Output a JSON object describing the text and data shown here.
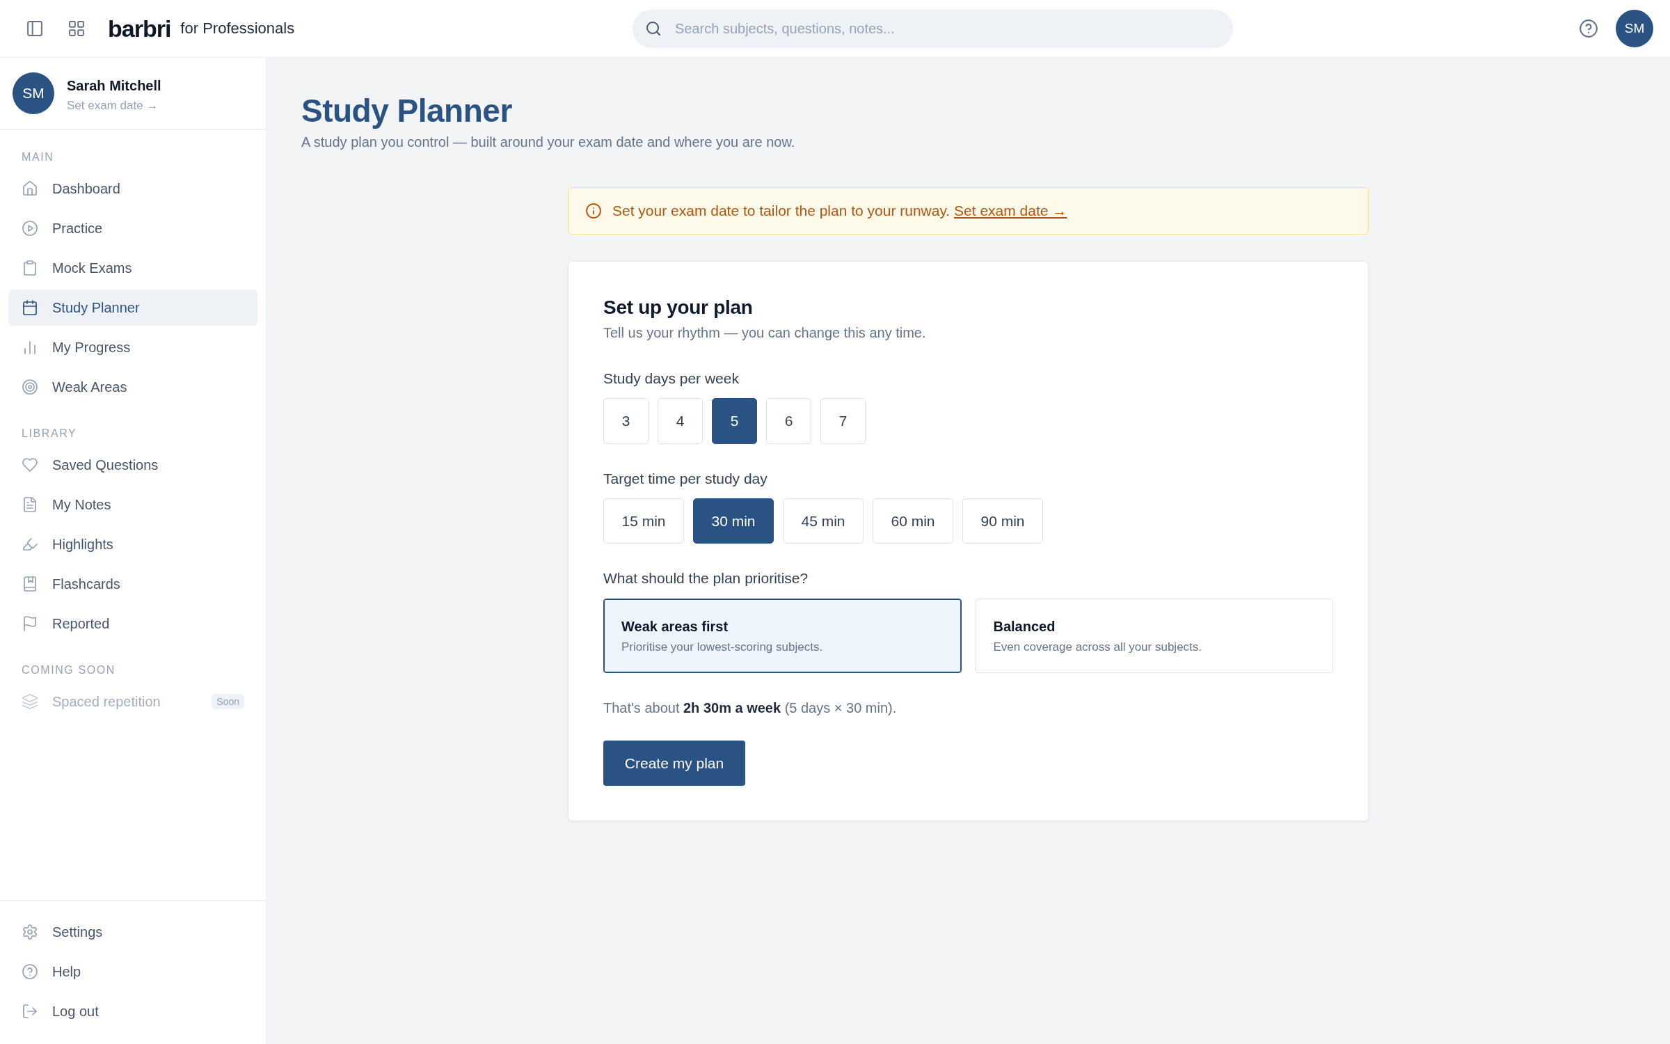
{
  "topbar": {
    "logo": "barbri",
    "tagline": "for Professionals",
    "search": {
      "placeholder": "Search subjects, questions, notes..."
    },
    "avatar": "SM"
  },
  "sidebar": {
    "profile": {
      "avatar": "SM",
      "name": "Sarah Mitchell",
      "link": "Set exam date →"
    },
    "sections": [
      {
        "title": "MAIN",
        "items": [
          {
            "label": "Dashboard",
            "selected": false,
            "disabled": false
          },
          {
            "label": "Practice",
            "selected": false,
            "disabled": false
          },
          {
            "label": "Mock Exams",
            "selected": false,
            "disabled": false
          },
          {
            "label": "Study Planner",
            "selected": true,
            "disabled": false
          },
          {
            "label": "My Progress",
            "selected": false,
            "disabled": false
          },
          {
            "label": "Weak Areas",
            "selected": false,
            "disabled": false
          }
        ]
      },
      {
        "title": "LIBRARY",
        "items": [
          {
            "label": "Saved Questions",
            "selected": false,
            "disabled": false
          },
          {
            "label": "My Notes",
            "selected": false,
            "disabled": false
          },
          {
            "label": "Highlights",
            "selected": false,
            "disabled": false
          },
          {
            "label": "Flashcards",
            "selected": false,
            "disabled": false
          },
          {
            "label": "Reported",
            "selected": false,
            "disabled": false
          }
        ]
      },
      {
        "title": "COMING SOON",
        "items": [
          {
            "label": "Spaced repetition",
            "selected": false,
            "disabled": true,
            "badge": "Soon"
          }
        ]
      }
    ],
    "footer_items": [
      {
        "label": "Settings",
        "selected": false
      },
      {
        "label": "Help",
        "selected": false
      },
      {
        "label": "Log out",
        "selected": false
      }
    ]
  },
  "page": {
    "title": "Study Planner",
    "subtitle": "A study plan you control — built around your exam date and where you are now."
  },
  "alert": {
    "text": "Set your exam date to tailor the plan to your runway.",
    "link": "Set exam date →"
  },
  "setup": {
    "title": "Set up your plan",
    "subtitle": "Tell us your rhythm — you can change this any time.",
    "days": {
      "label": "Study days per week",
      "options": [
        {
          "label": "3",
          "selected": false
        },
        {
          "label": "4",
          "selected": false
        },
        {
          "label": "5",
          "selected": true
        },
        {
          "label": "6",
          "selected": false
        },
        {
          "label": "7",
          "selected": false
        }
      ]
    },
    "time": {
      "label": "Target time per study day",
      "options": [
        {
          "label": "15 min",
          "selected": false
        },
        {
          "label": "30 min",
          "selected": true
        },
        {
          "label": "45 min",
          "selected": false
        },
        {
          "label": "60 min",
          "selected": false
        },
        {
          "label": "90 min",
          "selected": false
        }
      ]
    },
    "priority": {
      "label": "What should the plan prioritise?",
      "options": [
        {
          "title": "Weak areas first",
          "description": "Prioritise your lowest-scoring subjects.",
          "selected": true
        },
        {
          "title": "Balanced",
          "description": "Even coverage across all your subjects.",
          "selected": false
        }
      ]
    },
    "summary": "That's about **2h 30m a week** (5 days × 30 min).",
    "button": "Create my plan"
  }
}
